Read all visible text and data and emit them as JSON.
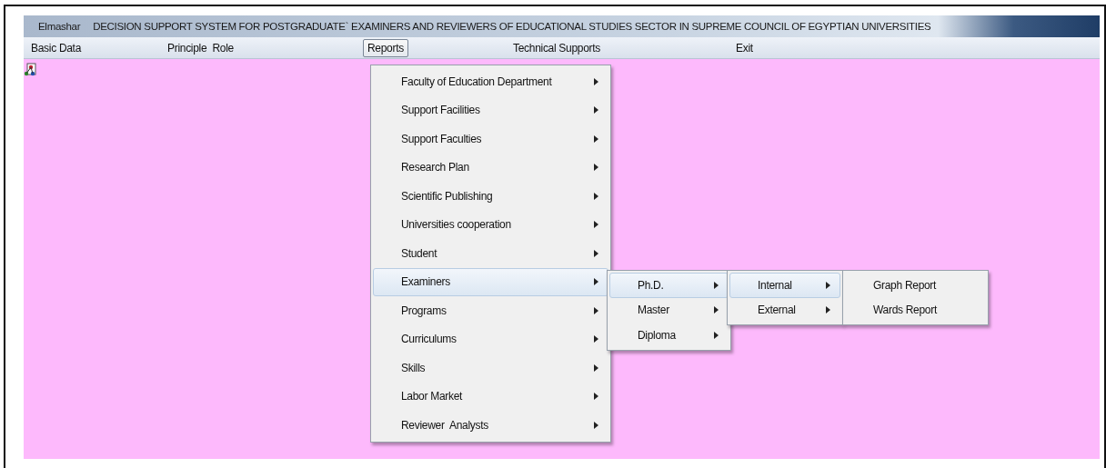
{
  "window": {
    "app_name": "Elmashar",
    "title": "DECISION SUPPORT SYSTEM FOR POSTGRADUATE` EXAMINERS AND REVIEWERS OF EDUCATIONAL STUDIES SECTOR IN SUPREME COUNCIL OF EGYPTIAN UNIVERSITIES"
  },
  "menubar": [
    {
      "label": "Basic Data",
      "selected": false
    },
    {
      "label": "Principle  Role",
      "selected": false
    },
    {
      "label": "Reports",
      "selected": true
    },
    {
      "label": "Technical Supports",
      "selected": false
    },
    {
      "label": "Exit",
      "selected": false
    }
  ],
  "menus": [
    {
      "items": [
        {
          "label": "Faculty of Education Department",
          "submenu": true,
          "selected": false
        },
        {
          "label": "Support Facilities",
          "submenu": true,
          "selected": false
        },
        {
          "label": "Support Faculties",
          "submenu": true,
          "selected": false
        },
        {
          "label": "Research Plan",
          "submenu": true,
          "selected": false
        },
        {
          "label": "Scientific Publishing",
          "submenu": true,
          "selected": false
        },
        {
          "label": "Universities cooperation",
          "submenu": true,
          "selected": false
        },
        {
          "label": "Student",
          "submenu": true,
          "selected": false
        },
        {
          "label": "Examiners",
          "submenu": true,
          "selected": true
        },
        {
          "label": "Programs",
          "submenu": true,
          "selected": false
        },
        {
          "label": "Curriculums",
          "submenu": true,
          "selected": false
        },
        {
          "label": "Skills",
          "submenu": true,
          "selected": false
        },
        {
          "label": "Labor Market",
          "submenu": true,
          "selected": false
        },
        {
          "label": "Reviewer  Analysts",
          "submenu": true,
          "selected": false
        }
      ]
    },
    {
      "items": [
        {
          "label": "Ph.D.",
          "submenu": true,
          "selected": true
        },
        {
          "label": "Master",
          "submenu": true,
          "selected": false
        },
        {
          "label": "Diploma",
          "submenu": true,
          "selected": false
        }
      ]
    },
    {
      "items": [
        {
          "label": "Internal",
          "submenu": true,
          "selected": true
        },
        {
          "label": "External",
          "submenu": true,
          "selected": false
        }
      ]
    },
    {
      "items": [
        {
          "label": "Graph Report",
          "submenu": false,
          "selected": false
        },
        {
          "label": "Wards Report",
          "submenu": false,
          "selected": false
        }
      ]
    }
  ]
}
